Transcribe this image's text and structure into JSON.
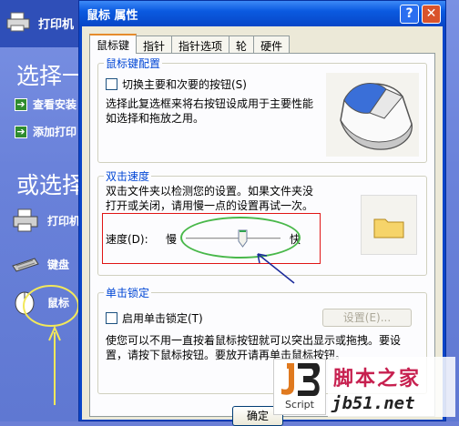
{
  "background": {
    "header_label": "打印机",
    "choose_heading": "选择一",
    "links": [
      "查看安装",
      "添加打印"
    ],
    "or_heading": "或选择",
    "items": [
      "打印机",
      "键盘",
      "鼠标"
    ]
  },
  "dialog": {
    "title": "鼠标 属性",
    "help_glyph": "?",
    "close_glyph": "✕",
    "tabs": [
      "鼠标键",
      "指针",
      "指针选项",
      "轮",
      "硬件"
    ],
    "button_config": {
      "title": "鼠标键配置",
      "checkbox_label": "切换主要和次要的按钮(S)",
      "description_line1": "选择此复选框来将右按钮设成用于主要性能",
      "description_line2": "如选择和拖放之用。"
    },
    "double_click": {
      "title": "双击速度",
      "description_line1": "双击文件夹以检测您的设置。如果文件夹没",
      "description_line2": "打开或关闭，请用慢一点的设置再试一次。",
      "speed_label": "速度(D):",
      "slow_label": "慢",
      "fast_label": "快",
      "slider_value": 0.6
    },
    "click_lock": {
      "title": "单击锁定",
      "checkbox_label": "启用单击锁定(T)",
      "settings_button": "设置(E)...",
      "description_line1": "使您可以不用一直按着鼠标按钮就可以突出显示或拖拽。要设",
      "description_line2": "置，请按下鼠标按钮。要放开请再单击鼠标按钮。"
    },
    "ok_button": "确定"
  },
  "watermark": {
    "script_label": "Script",
    "site_name": "脚本之家",
    "url": "jb51.net"
  },
  "colors": {
    "group_title": "#0046d5",
    "annotation_ellipse": "#49b84a",
    "annotation_frame": "#e01515",
    "annotation_arrow": "#1a2a9a"
  }
}
